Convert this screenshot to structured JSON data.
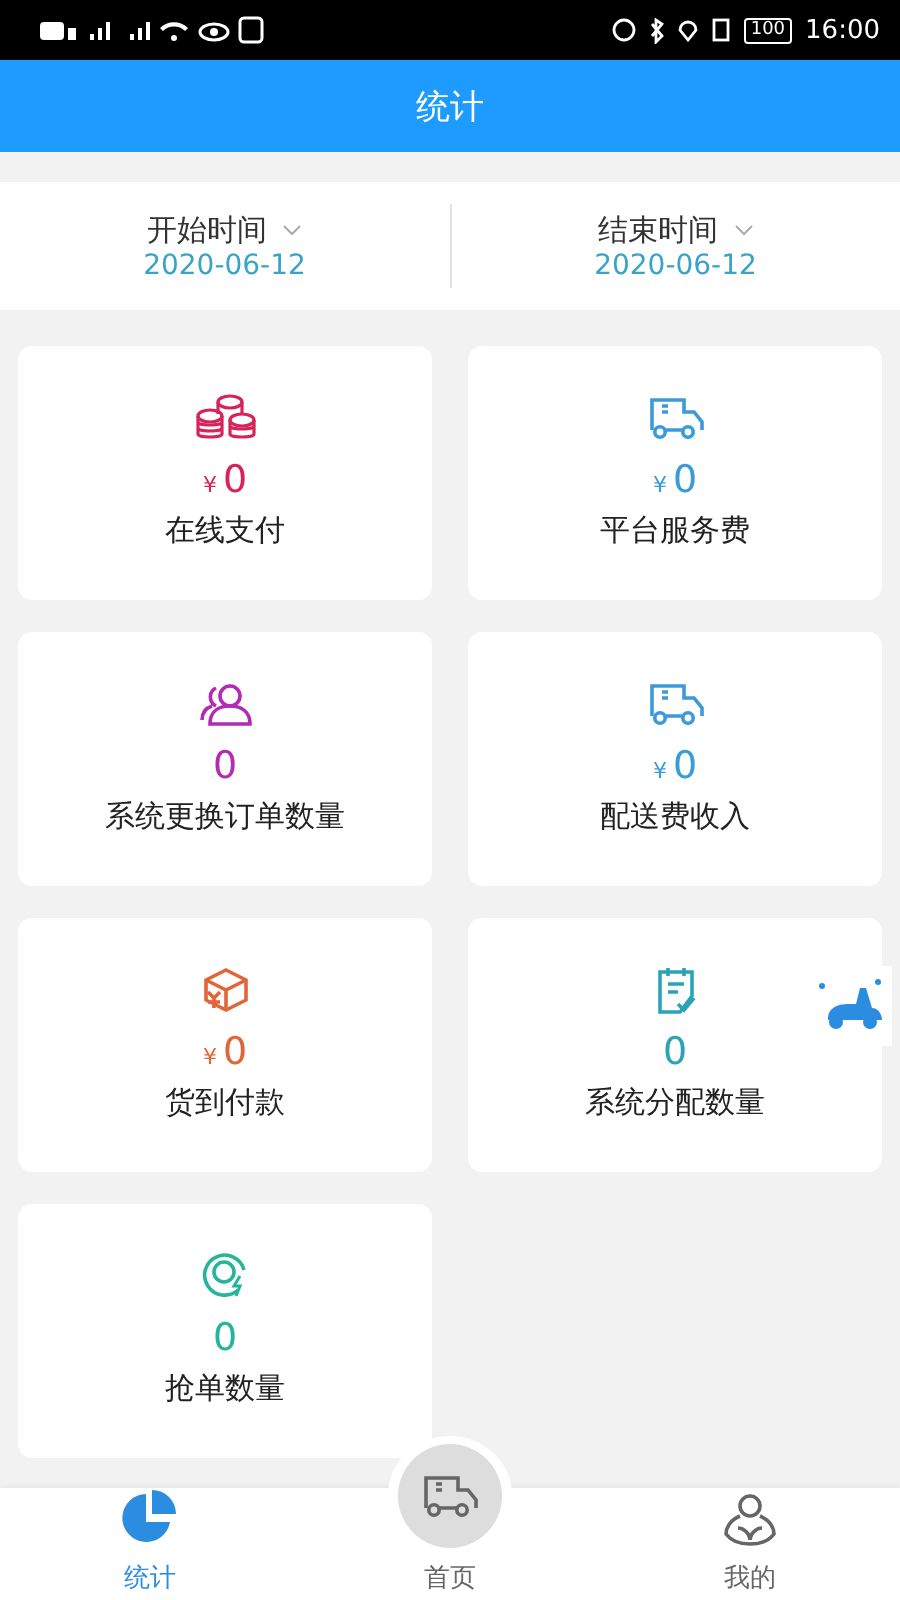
{
  "status_bar": {
    "battery": "100",
    "time": "16:00"
  },
  "header": {
    "title": "统计"
  },
  "date_range": [
    {
      "label": "开始时间",
      "value": "2020-06-12"
    },
    {
      "label": "结束时间",
      "value": "2020-06-12"
    }
  ],
  "cards": [
    {
      "kind": "coins",
      "color": "#d6245a",
      "currency": "¥",
      "value": "0",
      "label": "在线支付"
    },
    {
      "kind": "truck",
      "color": "#3b9ad9",
      "currency": "¥",
      "value": "0",
      "label": "平台服务费"
    },
    {
      "kind": "users",
      "color": "#b22bb5",
      "value": "0",
      "label": "系统更换订单数量"
    },
    {
      "kind": "truck",
      "color": "#3b9ad9",
      "currency": "¥",
      "value": "0",
      "label": "配送费收入"
    },
    {
      "kind": "box",
      "color": "#e0663a",
      "currency": "¥",
      "value": "0",
      "label": "货到付款"
    },
    {
      "kind": "clipboard",
      "color": "#2aa3b8",
      "value": "0",
      "label": "系统分配数量"
    },
    {
      "kind": "target",
      "color": "#26b59a",
      "value": "0",
      "label": "抢单数量"
    }
  ],
  "bottom_nav": [
    {
      "kind": "pie",
      "label": "统计",
      "selected": true
    },
    {
      "kind": "truck",
      "label": "首页",
      "selected": false,
      "raised": true
    },
    {
      "kind": "user",
      "label": "我的",
      "selected": false
    }
  ]
}
